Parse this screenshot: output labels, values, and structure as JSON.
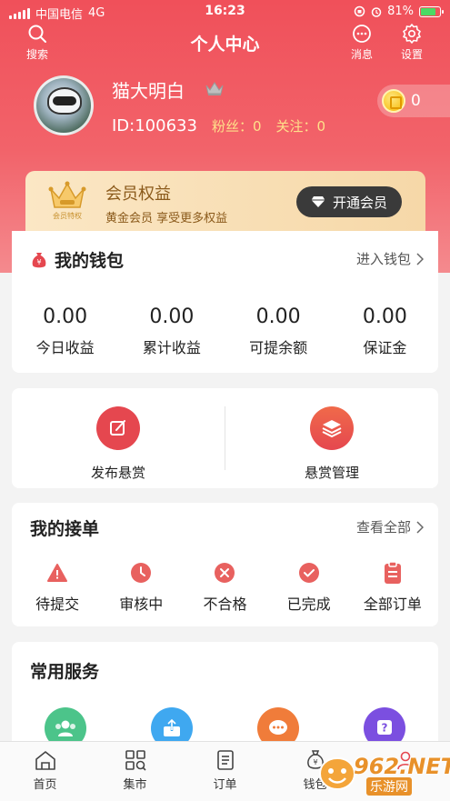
{
  "status_bar": {
    "carrier": "中国电信",
    "network": "4G",
    "time": "16:23",
    "battery": "81%"
  },
  "nav": {
    "title": "个人中心",
    "search_label": "搜索",
    "message_label": "消息",
    "settings_label": "设置"
  },
  "profile": {
    "username": "猫大明白",
    "id_text": "ID:100633",
    "fans_text": "粉丝：0",
    "follow_text": "关注：0",
    "coins": "0"
  },
  "vip": {
    "title": "会员权益",
    "subtitle": "黄金会员 享受更多权益",
    "button_label": "开通会员",
    "badge_text": "会员特权"
  },
  "wallet": {
    "title": "我的钱包",
    "link_label": "进入钱包",
    "stats": [
      {
        "value": "0.00",
        "label": "今日收益"
      },
      {
        "value": "0.00",
        "label": "累计收益"
      },
      {
        "value": "0.00",
        "label": "可提余额"
      },
      {
        "value": "0.00",
        "label": "保证金"
      }
    ]
  },
  "bounty": {
    "publish_label": "发布悬赏",
    "manage_label": "悬赏管理"
  },
  "orders": {
    "title": "我的接单",
    "link_label": "查看全部",
    "items": [
      {
        "label": "待提交",
        "icon": "warning-icon"
      },
      {
        "label": "审核中",
        "icon": "clock-icon"
      },
      {
        "label": "不合格",
        "icon": "x-circle-icon"
      },
      {
        "label": "已完成",
        "icon": "check-circle-icon"
      },
      {
        "label": "全部订单",
        "icon": "clipboard-icon"
      }
    ]
  },
  "services": {
    "title": "常用服务",
    "items": [
      {
        "icon": "users-icon",
        "color": "#4cc48a"
      },
      {
        "icon": "share-icon",
        "color": "#3fa8f0"
      },
      {
        "icon": "chat-icon",
        "color": "#f07c3a"
      },
      {
        "icon": "help-icon",
        "color": "#7b4fe0"
      }
    ]
  },
  "tabbar": {
    "home": "首页",
    "market": "集市",
    "orders": "订单",
    "wallet": "钱包",
    "mine": ""
  },
  "watermark": {
    "brand": "962.NET",
    "site": "乐游网"
  },
  "colors": {
    "primary": "#f0505a",
    "gold": "#8b5a1b",
    "accent_yellow": "#ffe08a"
  }
}
